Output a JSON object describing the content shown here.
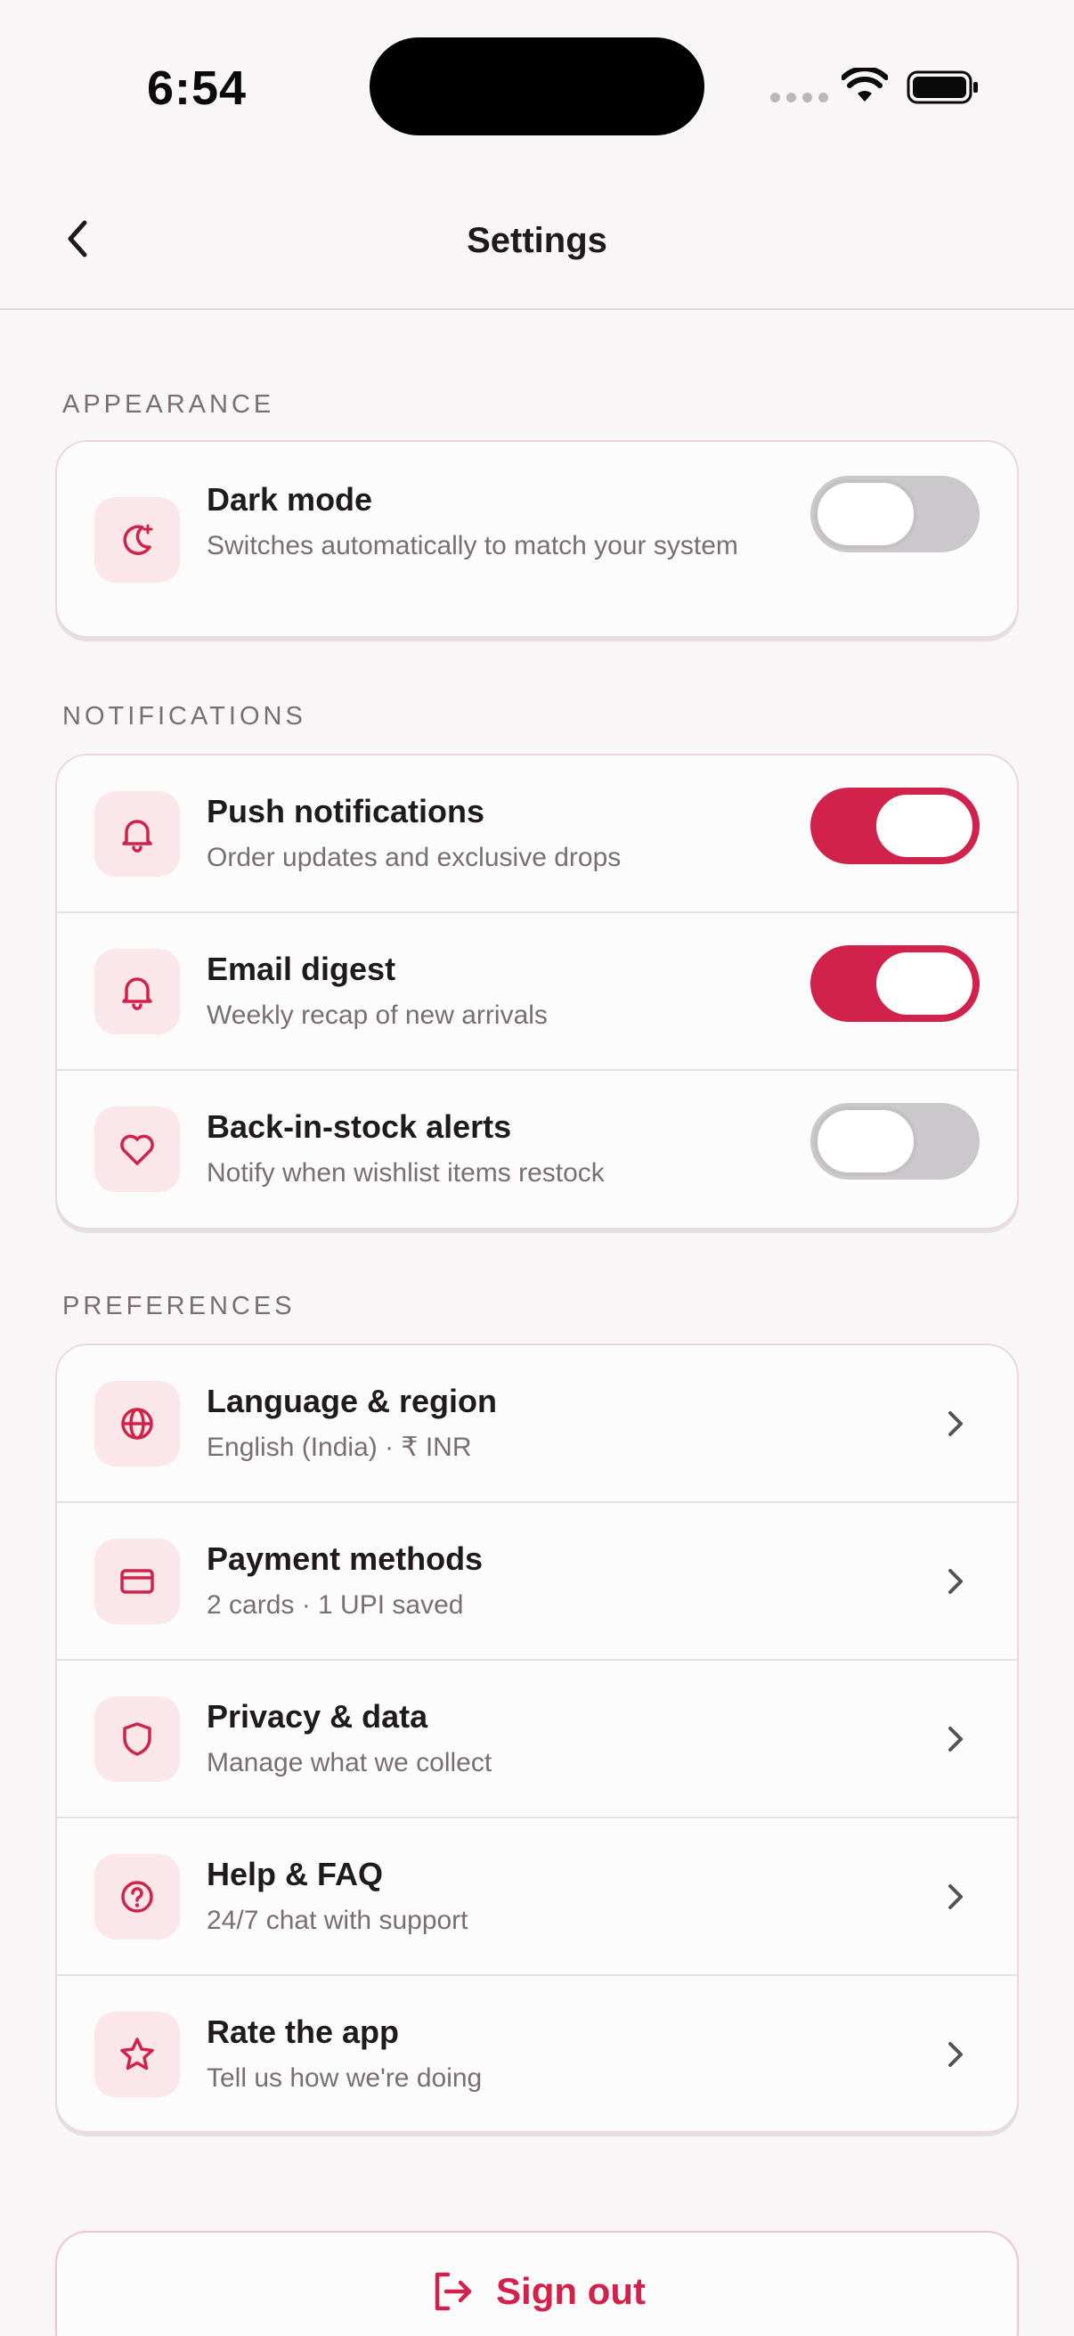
{
  "status_bar": {
    "time": "6:54"
  },
  "nav": {
    "title": "Settings"
  },
  "colors": {
    "accent": "#d0224a",
    "icon_bg": "#fbe6ea",
    "toggle_off": "#cbc8cb"
  },
  "sections": {
    "appearance": {
      "label": "APPEARANCE",
      "items": [
        {
          "icon": "moon-icon",
          "title": "Dark mode",
          "subtitle": "Switches automatically to match your system",
          "toggle": false
        }
      ]
    },
    "notifications": {
      "label": "NOTIFICATIONS",
      "items": [
        {
          "icon": "bell-icon",
          "title": "Push notifications",
          "subtitle": "Order updates and exclusive drops",
          "toggle": true
        },
        {
          "icon": "bell-icon",
          "title": "Email digest",
          "subtitle": "Weekly recap of new arrivals",
          "toggle": true
        },
        {
          "icon": "heart-icon",
          "title": "Back-in-stock alerts",
          "subtitle": "Notify when wishlist items restock",
          "toggle": false
        }
      ]
    },
    "preferences": {
      "label": "PREFERENCES",
      "items": [
        {
          "icon": "globe-icon",
          "title": "Language & region",
          "subtitle": "English (India) · ₹ INR"
        },
        {
          "icon": "credit-card-icon",
          "title": "Payment methods",
          "subtitle": "2 cards · 1 UPI saved"
        },
        {
          "icon": "shield-icon",
          "title": "Privacy & data",
          "subtitle": "Manage what we collect"
        },
        {
          "icon": "help-circle-icon",
          "title": "Help & FAQ",
          "subtitle": "24/7 chat with support"
        },
        {
          "icon": "star-icon",
          "title": "Rate the app",
          "subtitle": "Tell us how we're doing"
        }
      ]
    }
  },
  "signout": {
    "label": "Sign out",
    "icon": "logout-icon"
  }
}
